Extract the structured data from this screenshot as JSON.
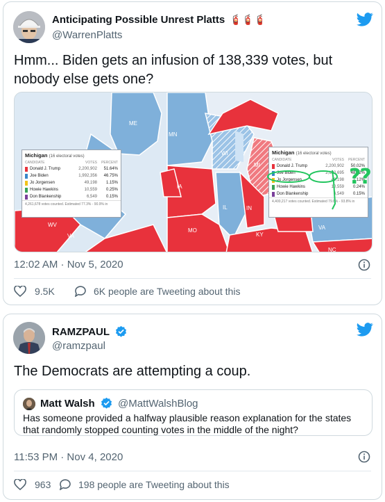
{
  "tweet1": {
    "name": "Anticipating Possible Unrest Platts",
    "handle": "@WarrenPlatts",
    "text": "Hmm... Biden gets an infusion of 138,339 votes, but nobody else gets one?",
    "timestamp": "12:02 AM · Nov 5, 2020",
    "likes": "9.5K",
    "tweeting": "6K people are Tweeting about this",
    "map": {
      "state_labels": [
        "ME",
        "MN",
        "WI",
        "MI",
        "IA",
        "IL",
        "IN",
        "MO",
        "KY",
        "WV",
        "VA",
        "VA",
        "NC"
      ],
      "left_panel": {
        "title": "Michigan",
        "subtitle": "(16 electoral votes)",
        "header": [
          "Candidate",
          "Votes",
          "Percent"
        ],
        "rows": [
          {
            "name": "Donald J. Trump",
            "votes": "2,200,902",
            "pct": "51.64%",
            "color": "#e8323c"
          },
          {
            "name": "Joe Biden",
            "votes": "1,992,356",
            "pct": "46.75%",
            "color": "#3a86c8"
          },
          {
            "name": "Jo Jorgensen",
            "votes": "49,198",
            "pct": "1.15%",
            "color": "#f2c21a"
          },
          {
            "name": "Howie Hawkins",
            "votes": "10,559",
            "pct": "0.25%",
            "color": "#3aa35a"
          },
          {
            "name": "Don Blankenship",
            "votes": "6,549",
            "pct": "0.15%",
            "color": "#7a3f9a"
          }
        ],
        "footer": "4,261,678 votes counted. Estimated 77.3% - 90.9% in"
      },
      "right_panel": {
        "title": "Michigan",
        "subtitle": "(16 electoral votes)",
        "header": [
          "Candidate",
          "Votes",
          "Percent"
        ],
        "rows": [
          {
            "name": "Donald J. Trump",
            "votes": "2,200,902",
            "pct": "50.02%",
            "color": "#e8323c"
          },
          {
            "name": "Joe Biden",
            "votes": "2,130,695",
            "pct": "48.42%",
            "color": "#3a86c8"
          },
          {
            "name": "Jo Jorgensen",
            "votes": "49,198",
            "pct": "1.12%",
            "color": "#f2c21a"
          },
          {
            "name": "Howie Hawkins",
            "votes": "10,559",
            "pct": "0.24%",
            "color": "#3aa35a"
          },
          {
            "name": "Don Blankenship",
            "votes": "6,549",
            "pct": "0.15%",
            "color": "#7a3f9a"
          }
        ],
        "footer": "4,400,217 votes counted. Estimated 79.8% - 93.8% in",
        "annotation": "??"
      }
    }
  },
  "tweet2": {
    "name": "RAMZPAUL",
    "handle": "@ramzpaul",
    "text": "The Democrats are attempting a coup.",
    "timestamp": "11:53 PM · Nov 4, 2020",
    "likes": "963",
    "tweeting": "198 people are Tweeting about this",
    "quote": {
      "name": "Matt Walsh",
      "handle": "@MattWalshBlog",
      "text": "Has someone provided a halfway plausible reason explanation for the states that randomly stopped counting votes in the middle of the night?"
    }
  },
  "colors": {
    "twitter_blue": "#1d9bf0",
    "republican_red": "#e8323c",
    "democrat_blue": "#7fb0da",
    "muted_text": "#536471"
  }
}
